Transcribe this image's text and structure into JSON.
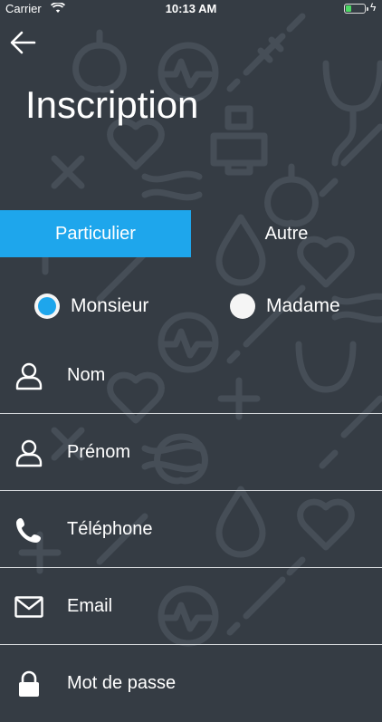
{
  "status_bar": {
    "carrier": "Carrier",
    "time": "10:13 AM",
    "wifi_icon": "wifi-icon",
    "battery_icon": "battery-icon",
    "charge_icon": "charging-bolt-icon"
  },
  "header": {
    "back_icon": "arrow-left-icon",
    "title": "Inscription"
  },
  "tabs": [
    {
      "label": "Particulier",
      "selected": true
    },
    {
      "label": "Autre",
      "selected": false
    }
  ],
  "civility": [
    {
      "label": "Monsieur",
      "selected": true
    },
    {
      "label": "Madame",
      "selected": false
    }
  ],
  "fields": [
    {
      "label": "Nom",
      "icon": "user-icon"
    },
    {
      "label": "Prénom",
      "icon": "user-icon"
    },
    {
      "label": "Téléphone",
      "icon": "phone-icon"
    },
    {
      "label": "Email",
      "icon": "mail-icon"
    },
    {
      "label": "Mot de passe",
      "icon": "lock-icon"
    }
  ],
  "colors": {
    "background": "#353c44",
    "pattern": "#464e57",
    "accent": "#1ea6ec",
    "text": "#ffffff",
    "divider": "#d9dcdf"
  }
}
